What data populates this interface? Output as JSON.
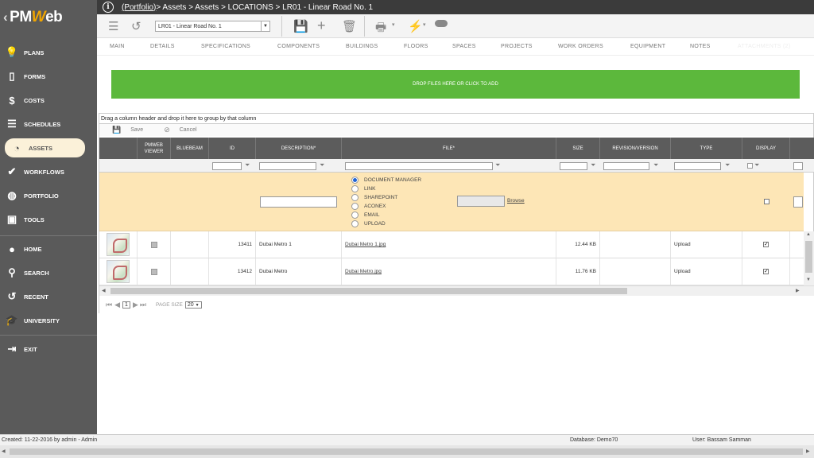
{
  "app": {
    "logo_prefix": "PM",
    "logo_w": "W",
    "logo_suffix": "eb"
  },
  "breadcrumb": {
    "portfolio": "(Portfolio)",
    "rest": " > Assets > Assets > LOCATIONS > LR01 - Linear Road No. 1"
  },
  "toolbar": {
    "record_select": "LR01 - Linear Road No. 1"
  },
  "sidebar": {
    "items": [
      {
        "label": "PLANS",
        "icon": "lightbulb-icon"
      },
      {
        "label": "FORMS",
        "icon": "document-icon"
      },
      {
        "label": "COSTS",
        "icon": "dollar-icon"
      },
      {
        "label": "SCHEDULES",
        "icon": "schedule-icon"
      },
      {
        "label": "ASSETS",
        "icon": "assets-icon"
      },
      {
        "label": "WORKFLOWS",
        "icon": "checkmark-icon"
      },
      {
        "label": "PORTFOLIO",
        "icon": "globe-icon"
      },
      {
        "label": "TOOLS",
        "icon": "toolbox-icon"
      },
      {
        "label": "HOME",
        "icon": "home-icon"
      },
      {
        "label": "SEARCH",
        "icon": "search-icon"
      },
      {
        "label": "RECENT",
        "icon": "recent-icon"
      },
      {
        "label": "UNIVERSITY",
        "icon": "graduation-cap-icon"
      },
      {
        "label": "EXIT",
        "icon": "exit-icon"
      }
    ]
  },
  "tabs": [
    "MAIN",
    "DETAILS",
    "SPECIFICATIONS",
    "COMPONENTS",
    "BUILDINGS",
    "FLOORS",
    "SPACES",
    "PROJECTS",
    "WORK ORDERS",
    "EQUIPMENT",
    "NOTES",
    "ATTACHMENTS (2)"
  ],
  "dropzone": "DROP FILES HERE OR CLICK TO ADD",
  "grid": {
    "group_hint": "Drag a column header and drop it here to group by that column",
    "save": "Save",
    "cancel": "Cancel",
    "headers": {
      "viewer": "PMWEB VIEWER",
      "bluebeam": "BLUEBEAM",
      "id": "ID",
      "description": "DESCRIPTION*",
      "file": "FILE*",
      "size": "SIZE",
      "revision": "REVISION/VERSION",
      "type": "TYPE",
      "display": "DISPLAY"
    },
    "sources": [
      "DOCUMENT MANAGER",
      "LINK",
      "SHAREPOINT",
      "ACONEX",
      "EMAIL",
      "UPLOAD"
    ],
    "browse": "Browse",
    "rows": [
      {
        "id": "13411",
        "description": "Dubai Metro 1",
        "file": "Dubai Metro 1.jpg",
        "size": "12.44 KB",
        "type": "Upload"
      },
      {
        "id": "13412",
        "description": "Dubai Metro",
        "file": "Dubai Metro.jpg",
        "size": "11.76 KB",
        "type": "Upload"
      }
    ],
    "page": "1",
    "page_size_label": "PAGE SIZE",
    "page_size": "20"
  },
  "status": {
    "created": "Created:  11-22-2016 by admin - Admin",
    "database": "Database:   Demo70",
    "user": "User:   Bassam Samman"
  }
}
